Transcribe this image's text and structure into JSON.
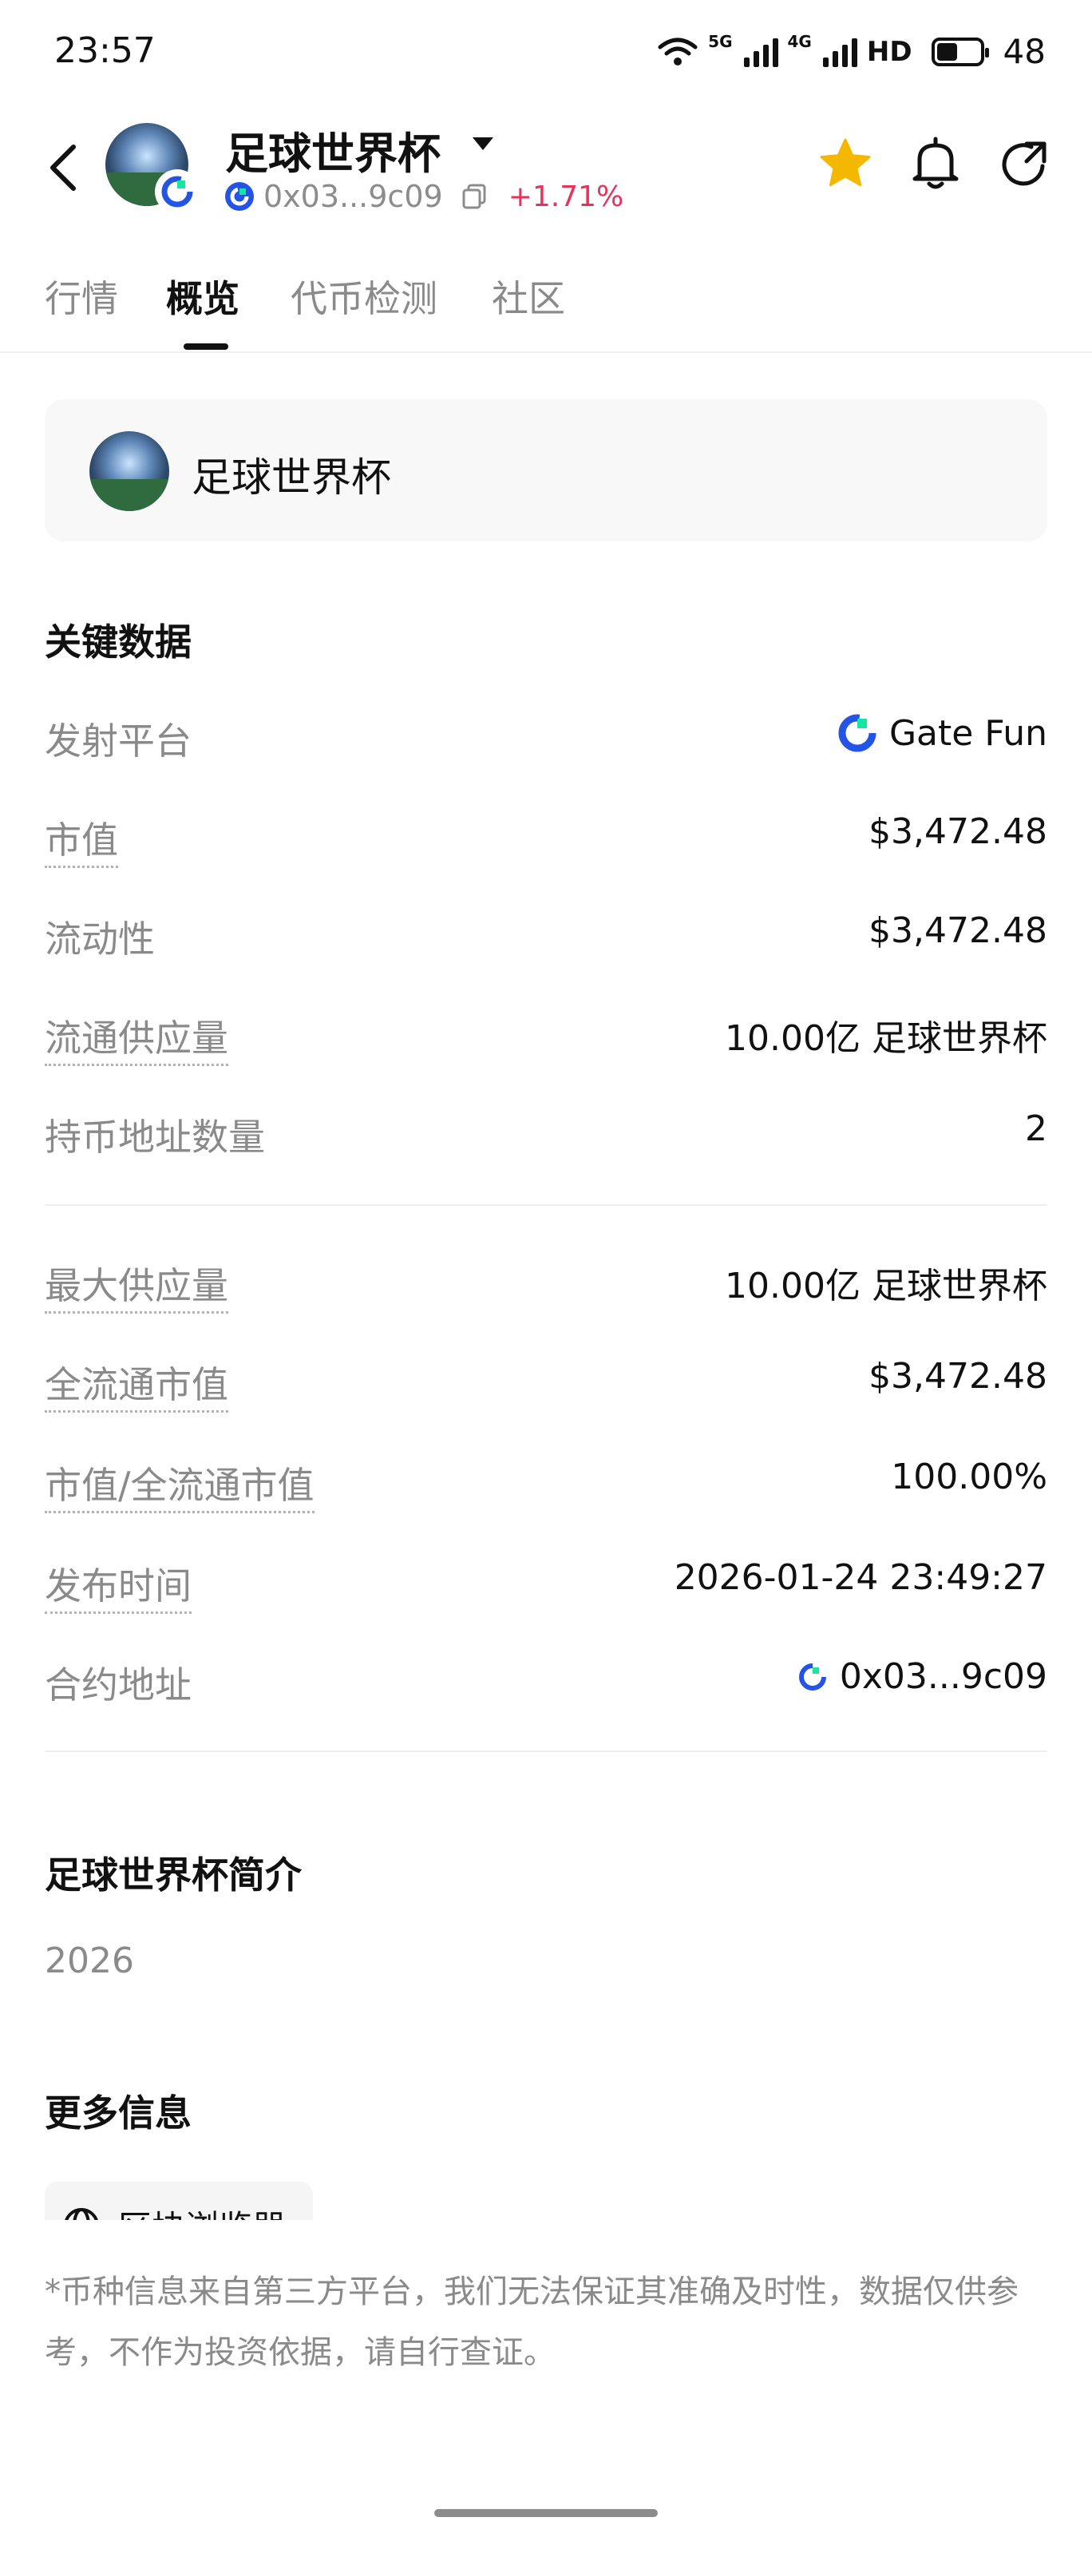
{
  "status_bar": {
    "time": "23:57",
    "network_5g": "5G",
    "network_4g": "4G",
    "hd": "HD",
    "battery": "48"
  },
  "header": {
    "token_name": "足球世界杯",
    "address": "0x03...9c09",
    "change": "+1.71%",
    "change_color": "#e6335d",
    "star_color": "#f5b800"
  },
  "tabs": [
    {
      "label": "行情",
      "active": false
    },
    {
      "label": "概览",
      "active": true
    },
    {
      "label": "代币检测",
      "active": false
    },
    {
      "label": "社区",
      "active": false
    }
  ],
  "token_card": {
    "name": "足球世界杯"
  },
  "key_data": {
    "title": "关键数据",
    "launch_platform": {
      "label": "发射平台",
      "value": "Gate Fun"
    },
    "market_cap": {
      "label": "市值",
      "value": "$3,472.48"
    },
    "liquidity": {
      "label": "流动性",
      "value": "$3,472.48"
    },
    "circulating_supply": {
      "label": "流通供应量",
      "value": "10.00亿 足球世界杯"
    },
    "holders": {
      "label": "持币地址数量",
      "value": "2"
    },
    "max_supply": {
      "label": "最大供应量",
      "value": "10.00亿 足球世界杯"
    },
    "fdv": {
      "label": "全流通市值",
      "value": "$3,472.48"
    },
    "mc_fdv_ratio": {
      "label": "市值/全流通市值",
      "value": "100.00%"
    },
    "launch_time": {
      "label": "发布时间",
      "value": "2026-01-24 23:49:27"
    },
    "contract_address": {
      "label": "合约地址",
      "value": "0x03...9c09"
    }
  },
  "intro": {
    "title": "足球世界杯简介",
    "text": "2026"
  },
  "more_info": {
    "title": "更多信息",
    "explorer_label": "区块浏览器"
  },
  "disclaimer": "*币种信息来自第三方平台，我们无法保证其准确及时性，数据仅供参考，不作为投资依据，请自行查证。",
  "colors": {
    "gate_blue": "#2354e6",
    "gate_green": "#17e5a0"
  }
}
